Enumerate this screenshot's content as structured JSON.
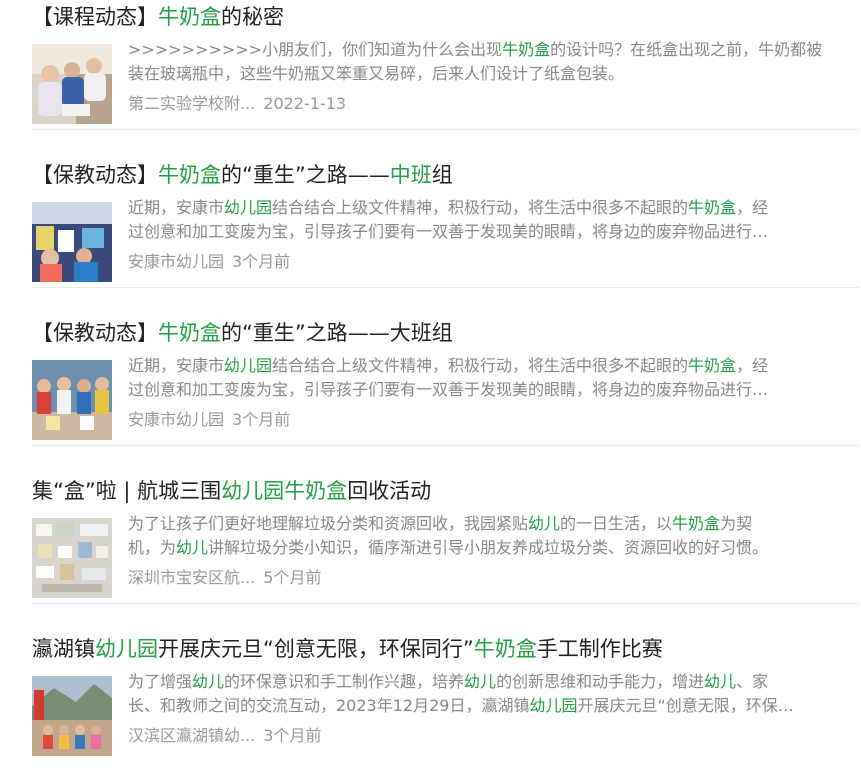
{
  "results": [
    {
      "title": [
        {
          "text": "【课程动态】",
          "hl": false
        },
        {
          "text": "牛奶盒",
          "hl": true
        },
        {
          "text": "的秘密",
          "hl": false
        }
      ],
      "summary_lines": [
        [
          {
            "text": ">>>>>>>>>>小朋友们，你们知道为什么会出现",
            "hl": false
          },
          {
            "text": "牛奶盒",
            "hl": true
          },
          {
            "text": "的设计吗？在纸盒出现之前，牛奶都被",
            "hl": false
          }
        ],
        [
          {
            "text": "装在玻璃瓶中，这些牛奶瓶又笨重又易碎，后来人们设计了纸盒包装。",
            "hl": false
          }
        ]
      ],
      "source": "第二实验学校附...",
      "time": "2022-1-13",
      "thumb": "classroom-photo"
    },
    {
      "title": [
        {
          "text": "【保教动态】",
          "hl": false
        },
        {
          "text": "牛奶盒",
          "hl": true
        },
        {
          "text": "的“重生”之路——",
          "hl": false
        },
        {
          "text": "中班",
          "hl": true
        },
        {
          "text": "组",
          "hl": false
        }
      ],
      "summary_lines": [
        [
          {
            "text": "近期，安康市",
            "hl": false
          },
          {
            "text": "幼儿园",
            "hl": true
          },
          {
            "text": "结合结合上级文件精神，积极行动，将生活中很多不起眼的",
            "hl": false
          },
          {
            "text": "牛奶盒",
            "hl": true
          },
          {
            "text": "，经",
            "hl": false
          }
        ],
        [
          {
            "text": "过创意和加工变废为宝，引导孩子们要有一双善于发现美的眼睛，将身边的废弃物品进行…",
            "hl": false
          }
        ]
      ],
      "source": "安康市幼儿园",
      "time": "3个月前",
      "thumb": "children-crafts-photo"
    },
    {
      "title": [
        {
          "text": "【保教动态】",
          "hl": false
        },
        {
          "text": "牛奶盒",
          "hl": true
        },
        {
          "text": "的“重生”之路——大班组",
          "hl": false
        }
      ],
      "summary_lines": [
        [
          {
            "text": "近期，安康市",
            "hl": false
          },
          {
            "text": "幼儿园",
            "hl": true
          },
          {
            "text": "结合结合上级文件精神，积极行动，将生活中很多不起眼的",
            "hl": false
          },
          {
            "text": "牛奶盒",
            "hl": true
          },
          {
            "text": "，经",
            "hl": false
          }
        ],
        [
          {
            "text": "过创意和加工变废为宝，引导孩子们要有一双善于发现美的眼睛，将身边的废弃物品进行…",
            "hl": false
          }
        ]
      ],
      "source": "安康市幼儿园",
      "time": "3个月前",
      "thumb": "kids-group-photo"
    },
    {
      "title": [
        {
          "text": "集“盒”啦 | 航城三围",
          "hl": false
        },
        {
          "text": "幼儿园",
          "hl": true
        },
        {
          "text": "牛奶盒",
          "hl": true
        },
        {
          "text": "回收活动",
          "hl": false
        }
      ],
      "summary_lines": [
        [
          {
            "text": "为了让孩子们更好地理解垃圾分类和资源回收，我园紧贴",
            "hl": false
          },
          {
            "text": "幼儿",
            "hl": true
          },
          {
            "text": "的一日生活，以",
            "hl": false
          },
          {
            "text": "牛奶盒",
            "hl": true
          },
          {
            "text": "为契",
            "hl": false
          }
        ],
        [
          {
            "text": "机，为",
            "hl": false
          },
          {
            "text": "幼儿",
            "hl": true
          },
          {
            "text": "讲解垃圾分类小知识，循序渐进引导小朋友养成垃圾分类、资源回收的好习惯。",
            "hl": false
          }
        ]
      ],
      "source": "深圳市宝安区航...",
      "time": "5个月前",
      "thumb": "recycling-board-photo"
    },
    {
      "title": [
        {
          "text": "瀛湖镇",
          "hl": false
        },
        {
          "text": "幼儿园",
          "hl": true
        },
        {
          "text": "开展庆元旦“创意无限，环保同行”",
          "hl": false
        },
        {
          "text": "牛奶盒",
          "hl": true
        },
        {
          "text": "手工制作比赛",
          "hl": false
        }
      ],
      "summary_lines": [
        [
          {
            "text": "为了增强",
            "hl": false
          },
          {
            "text": "幼儿",
            "hl": true
          },
          {
            "text": "的环保意识和手工制作兴趣，培养",
            "hl": false
          },
          {
            "text": "幼儿",
            "hl": true
          },
          {
            "text": "的创新思维和动手能力，增进",
            "hl": false
          },
          {
            "text": "幼儿",
            "hl": true
          },
          {
            "text": "、家",
            "hl": false
          }
        ],
        [
          {
            "text": "长、和教师之间的交流互动，2023年12月29日，瀛湖镇",
            "hl": false
          },
          {
            "text": "幼儿园",
            "hl": true
          },
          {
            "text": "开展庆元旦“创意无限，环保…",
            "hl": false
          }
        ]
      ],
      "source": "汉滨区瀛湖镇幼...",
      "time": "3个月前",
      "thumb": "outdoor-group-photo"
    }
  ]
}
